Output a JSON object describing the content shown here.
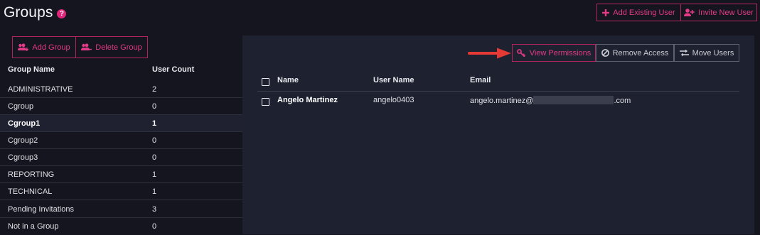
{
  "page": {
    "title": "Groups",
    "help_glyph": "?"
  },
  "header_actions": {
    "add_existing_user": "Add Existing User",
    "invite_new_user": "Invite New User"
  },
  "group_actions": {
    "add_group": "Add Group",
    "delete_group": "Delete Group"
  },
  "groups_table": {
    "headers": [
      "Group Name",
      "User Count"
    ],
    "rows": [
      {
        "name": "ADMINISTRATIVE",
        "count": "2"
      },
      {
        "name": "Cgroup",
        "count": "0"
      },
      {
        "name": "Cgroup1",
        "count": "1",
        "selected": true
      },
      {
        "name": "Cgroup2",
        "count": "0"
      },
      {
        "name": "Cgroup3",
        "count": "0"
      },
      {
        "name": "REPORTING",
        "count": "1"
      },
      {
        "name": "TECHNICAL",
        "count": "1"
      },
      {
        "name": "Pending Invitations",
        "count": "3"
      },
      {
        "name": "Not in a Group",
        "count": "0"
      }
    ]
  },
  "user_actions": {
    "view_permissions": "View Permissions",
    "remove_access": "Remove Access",
    "move_users": "Move Users"
  },
  "users_table": {
    "headers": {
      "name": "Name",
      "username": "User Name",
      "email": "Email"
    },
    "rows": [
      {
        "name": "Angelo Martinez",
        "username": "angelo0403",
        "email_prefix": "angelo.martinez@",
        "email_suffix": ".com"
      }
    ]
  },
  "colors": {
    "accent": "#e23a86",
    "background": "#14151e",
    "panel": "#1e2230",
    "arrow": "#e53935"
  },
  "icons": {
    "help": "help-icon",
    "add_existing_user": "plus-icon",
    "invite_new_user": "user-plus-icon",
    "add_group": "users-plus-icon",
    "delete_group": "users-minus-icon",
    "view_permissions": "key-icon",
    "remove_access": "ban-icon",
    "move_users": "swap-arrows-icon",
    "annotation": "red-arrow-icon"
  }
}
